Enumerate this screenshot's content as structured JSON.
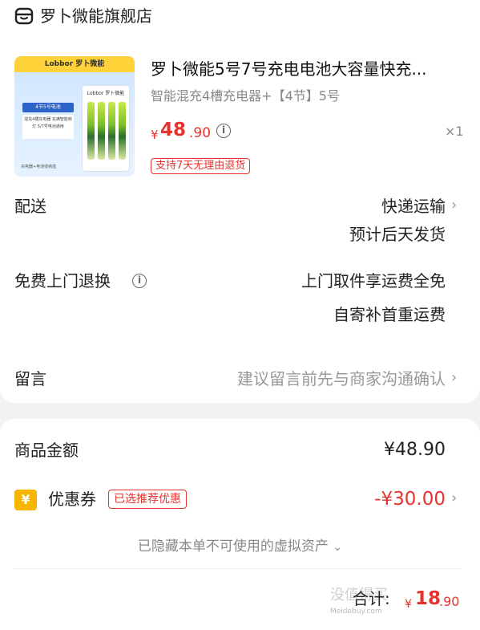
{
  "store": {
    "name": "罗卜微能旗舰店",
    "icon": "store-icon"
  },
  "product": {
    "image_brand": "Lobbor 罗卜微能",
    "image_tag": "4节5号电池",
    "image_note": "混充4槽充电器 充满智能转灯 5/7号电池通用",
    "image_box_label": "Lobbor 罗卜微能",
    "image_footer": "充电器+电池收纳盒",
    "title": "罗卜微能5号7号充电电池大容量快充...",
    "spec": "智能混充4槽充电器+【4节】5号",
    "price_symbol": "¥",
    "price_int": "48",
    "price_dec": ".90",
    "quantity": "×1",
    "return_policy": "支持7天无理由退货"
  },
  "delivery": {
    "label": "配送",
    "method": "快递运输",
    "eta": "预计后天发货"
  },
  "free_return": {
    "label": "免费上门退换",
    "line1": "上门取件享运费全免",
    "line2": "自寄补首重运费"
  },
  "message": {
    "label": "留言",
    "placeholder": "建议留言前先与商家沟通确认"
  },
  "summary": {
    "goods_label": "商品金额",
    "goods_amount": "¥48.90",
    "coupon_label": "优惠券",
    "coupon_badge": "已选推荐优惠",
    "coupon_amount": "-¥30.00",
    "hidden_assets": "已隐藏本单不可使用的虚拟资产",
    "total_label": "合计:",
    "total_symbol": "¥",
    "total_int": "18",
    "total_dec": ".90"
  },
  "watermark": {
    "text": "没值得买",
    "site": "Meidebuy.com"
  },
  "colors": {
    "accent": "#e8322d",
    "coupon": "#f7b500",
    "muted": "#999999"
  }
}
